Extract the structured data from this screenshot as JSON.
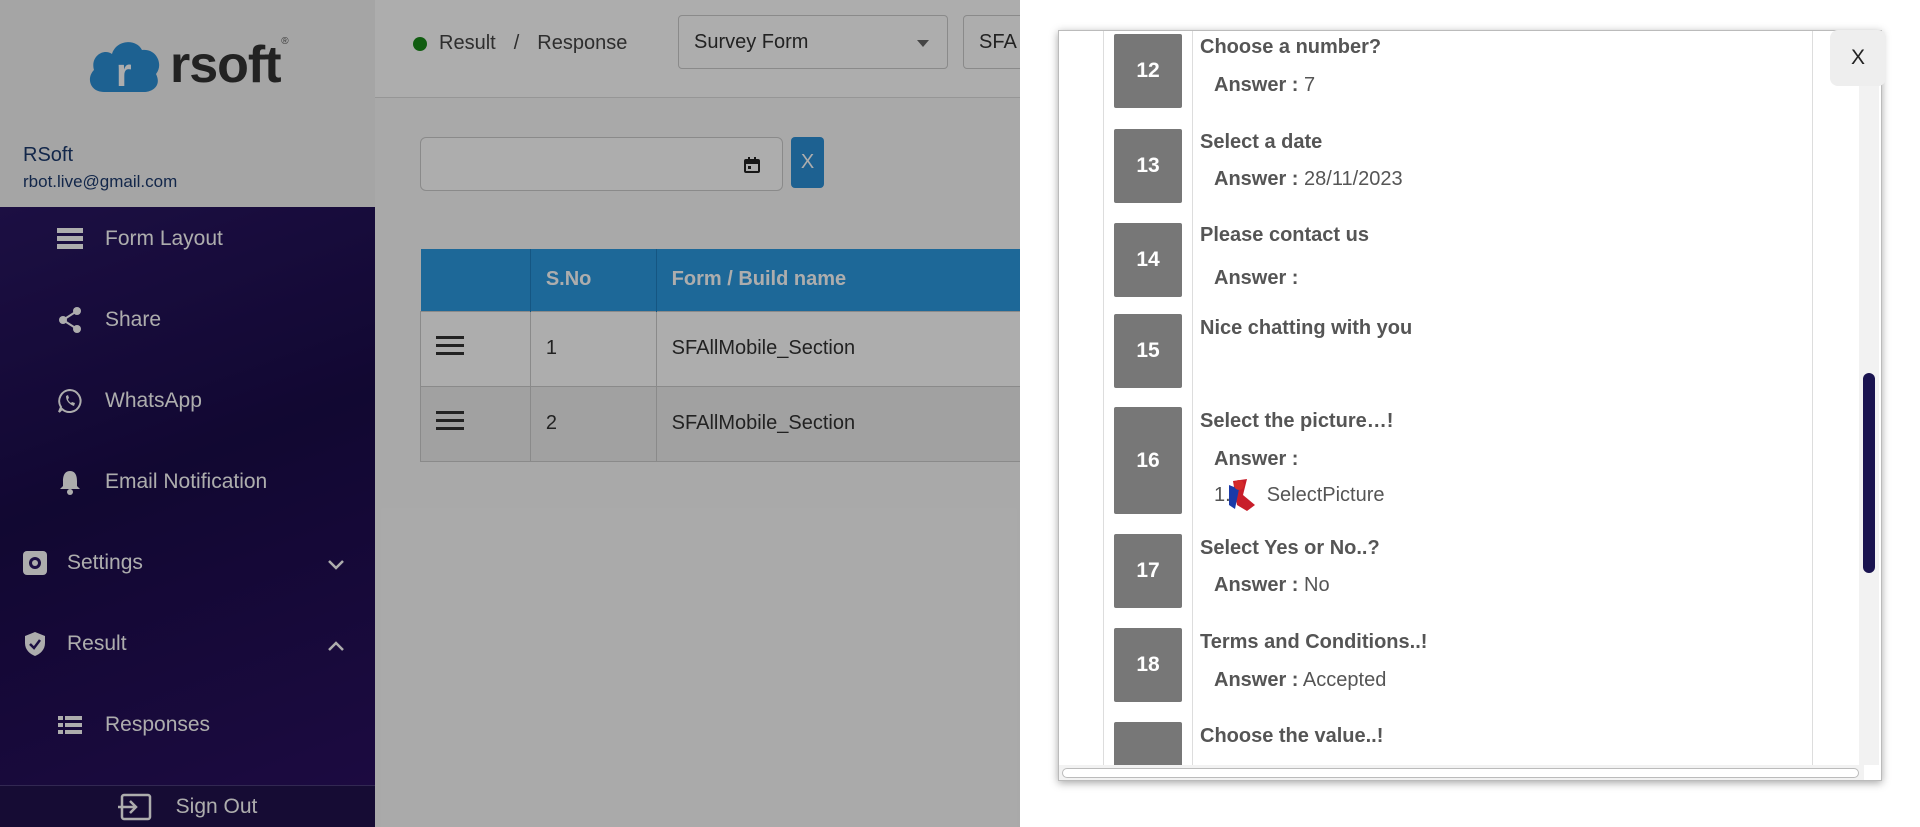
{
  "sidebar": {
    "logo_text": "rsoft",
    "logo_mark": "®",
    "user_name": "RSoft",
    "user_email": "rbot.live@gmail.com",
    "items": [
      {
        "label": "Form Layout",
        "icon": "layout-icon"
      },
      {
        "label": "Share",
        "icon": "share-icon"
      },
      {
        "label": "WhatsApp",
        "icon": "whatsapp-icon"
      },
      {
        "label": "Email Notification",
        "icon": "bell-icon"
      },
      {
        "label": "Settings",
        "icon": "gear-icon"
      },
      {
        "label": "Result",
        "icon": "shield-check-icon"
      },
      {
        "label": "Responses",
        "icon": "list-icon"
      }
    ],
    "sign_out": "Sign Out"
  },
  "header": {
    "breadcrumb": [
      "Result",
      "Response"
    ],
    "breadcrumb_sep": "/",
    "form_type_select": "Survey Form",
    "form_select": "SFA"
  },
  "filters": {
    "date_value": "",
    "clear_label": "X"
  },
  "table": {
    "columns": [
      "",
      "S.No",
      "Form / Build name"
    ],
    "rows": [
      {
        "sno": "1",
        "name": "SFAllMobile_Section"
      },
      {
        "sno": "2",
        "name": "SFAllMobile_Section"
      }
    ]
  },
  "panel": {
    "close_label": "X",
    "answer_label": "Answer :",
    "questions": [
      {
        "num": "12",
        "text": "Choose a number?",
        "answer": "7"
      },
      {
        "num": "13",
        "text": "Select a date",
        "answer": "28/11/2023"
      },
      {
        "num": "14",
        "text": "Please contact us",
        "answer": ""
      },
      {
        "num": "15",
        "text": "Nice chatting with you"
      },
      {
        "num": "16",
        "text": "Select the picture…!",
        "answer": "",
        "picture_index": "1.",
        "picture_label": "SelectPicture"
      },
      {
        "num": "17",
        "text": "Select Yes or No..?",
        "answer": "No"
      },
      {
        "num": "18",
        "text": "Terms and Conditions..!",
        "answer": "Accepted"
      },
      {
        "num": "",
        "text": "Choose the value..!"
      }
    ]
  },
  "colors": {
    "sidebar_bg": "#21124d",
    "accent": "#2b9ae0",
    "status_dot": "#1a8a1a",
    "number_badge": "#777777"
  }
}
